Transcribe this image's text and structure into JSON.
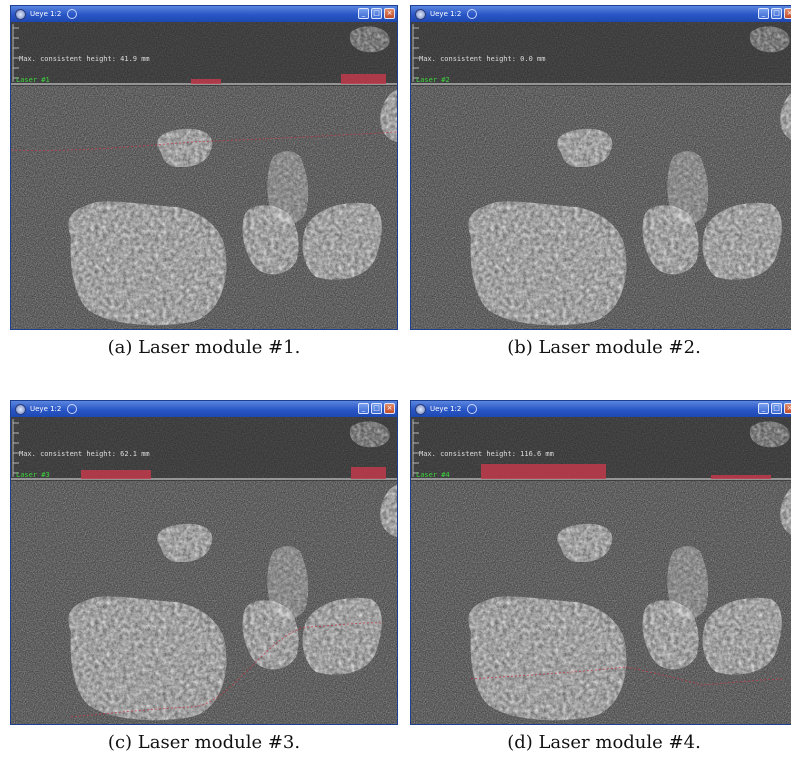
{
  "window_title": "Ueye 1:2",
  "panels": [
    {
      "id": "a",
      "readout": "Max. consistent height: 41.9 mm",
      "laser_label": "Laser #1",
      "caption": "(a) Laser module #1."
    },
    {
      "id": "b",
      "readout": "Max. consistent height: 0.0 mm",
      "laser_label": "Laser #2",
      "caption": "(b) Laser module #2."
    },
    {
      "id": "c",
      "readout": "Max. consistent height: 62.1 mm",
      "laser_label": "Laser #3",
      "caption": "(c) Laser module #3."
    },
    {
      "id": "d",
      "readout": "Max. consistent height: 116.6 mm",
      "laser_label": "Laser #4",
      "caption": "(d) Laser module #4."
    }
  ],
  "colors": {
    "titlebar": "#2956c6",
    "laser_line": "#c0394a",
    "overlay_text": "#dcdcdc",
    "laser_label": "#3bd43b"
  }
}
